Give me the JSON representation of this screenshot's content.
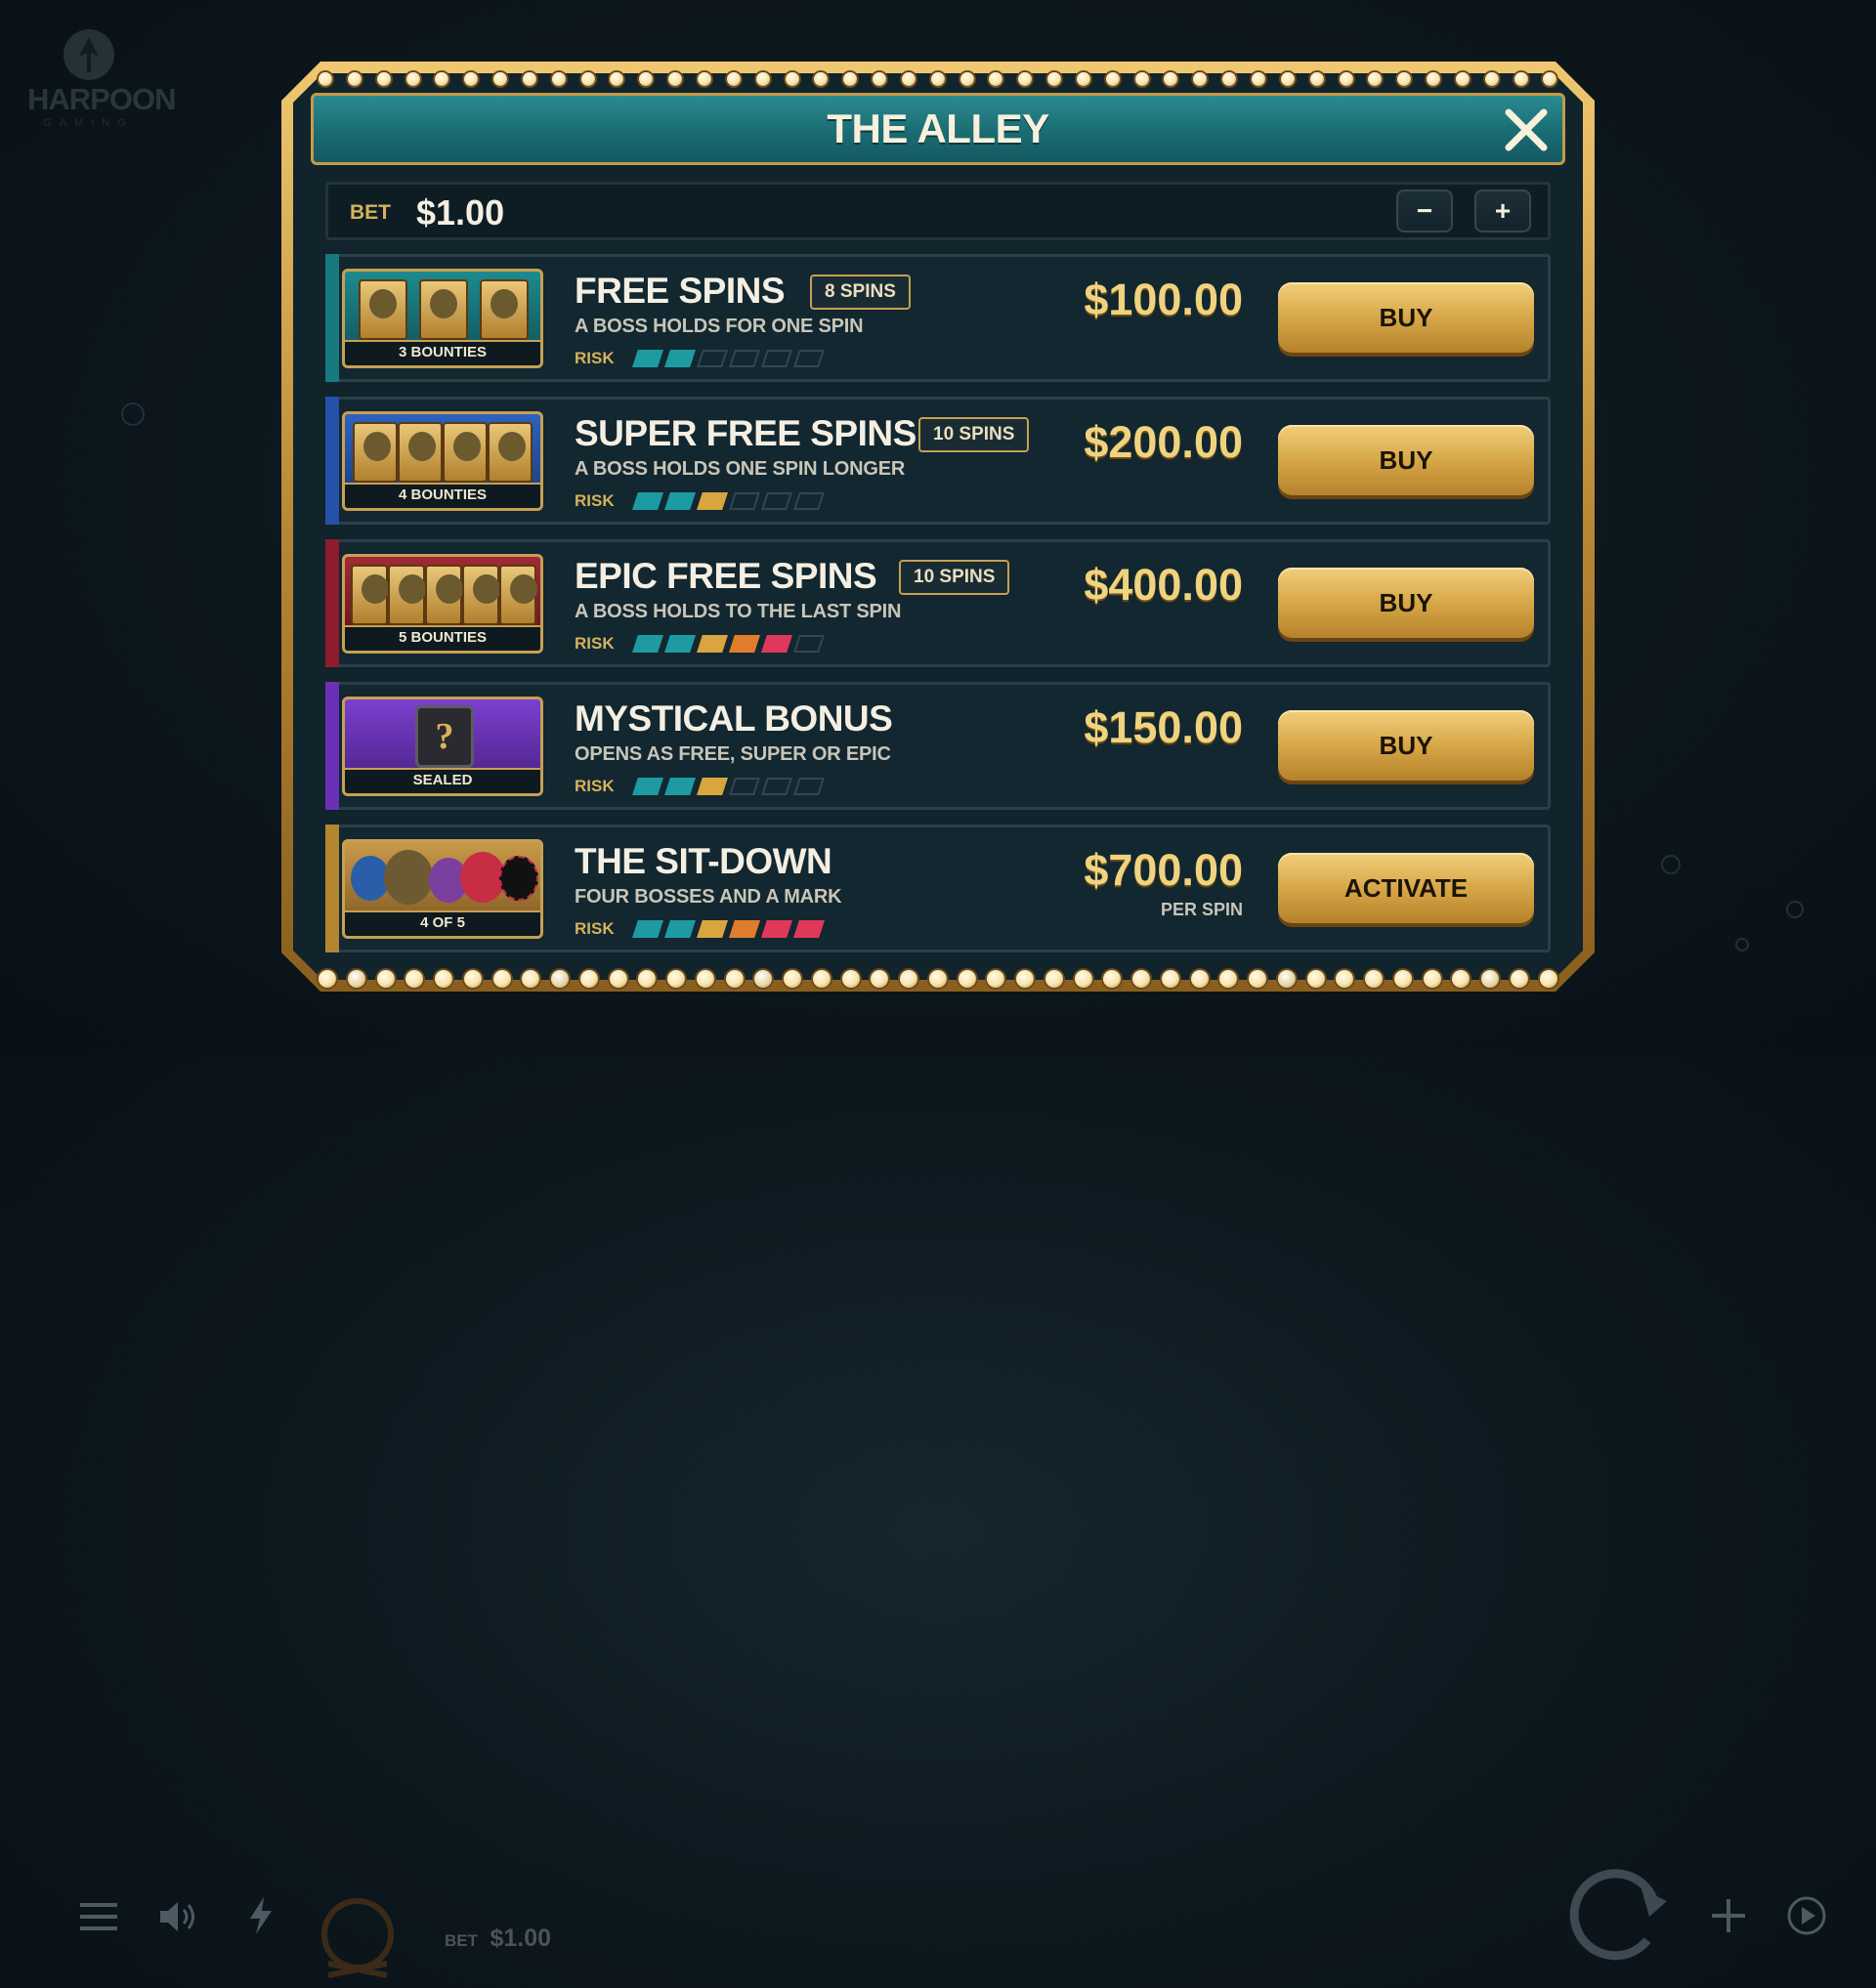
{
  "brand": {
    "name": "HARPOON",
    "sub": "GAMING"
  },
  "modal": {
    "title": "THE ALLEY"
  },
  "bet": {
    "label": "BET",
    "value": "$1.00",
    "minus": "−",
    "plus": "+"
  },
  "offers": [
    {
      "name": "FREE SPINS",
      "tag": "8 SPINS",
      "desc": "A BOSS HOLDS FOR ONE SPIN",
      "thumb_caption": "3 BOUNTIES",
      "price": "$100.00",
      "button": "BUY",
      "risk_label": "RISK",
      "risk": [
        "teal",
        "teal",
        "empty",
        "empty",
        "empty",
        "empty"
      ]
    },
    {
      "name": "SUPER FREE SPINS",
      "tag": "10 SPINS",
      "desc": "A BOSS HOLDS ONE SPIN LONGER",
      "thumb_caption": "4 BOUNTIES",
      "price": "$200.00",
      "button": "BUY",
      "risk_label": "RISK",
      "risk": [
        "teal",
        "teal",
        "gold",
        "empty",
        "empty",
        "empty"
      ]
    },
    {
      "name": "EPIC FREE SPINS",
      "tag": "10 SPINS",
      "desc": "A BOSS HOLDS TO THE LAST SPIN",
      "thumb_caption": "5 BOUNTIES",
      "price": "$400.00",
      "button": "BUY",
      "risk_label": "RISK",
      "risk": [
        "teal",
        "teal",
        "gold",
        "orange",
        "red",
        "empty"
      ]
    },
    {
      "name": "MYSTICAL BONUS",
      "desc": "OPENS AS FREE, SUPER OR EPIC",
      "thumb_caption": "SEALED",
      "price": "$150.00",
      "button": "BUY",
      "risk_label": "RISK",
      "risk": [
        "teal",
        "teal",
        "gold",
        "empty",
        "empty",
        "empty"
      ]
    },
    {
      "name": "THE SIT-DOWN",
      "desc": "FOUR BOSSES AND A MARK",
      "thumb_caption": "4 OF 5",
      "price": "$700.00",
      "price_note": "PER SPIN",
      "button": "ACTIVATE",
      "risk_label": "RISK",
      "risk": [
        "teal",
        "teal",
        "gold",
        "orange",
        "red",
        "red"
      ]
    }
  ],
  "bottom_bar": {
    "bet_label": "BET",
    "bet_value": "$1.00"
  },
  "colors": {
    "teal": "#1e9aa2",
    "gold": "#d9a53f",
    "orange": "#e07d2d",
    "red": "#e0385a",
    "stripe_free": "#177a7e",
    "stripe_super": "#2552a8",
    "stripe_epic": "#8e1c2c",
    "stripe_mystic": "#6a31b8",
    "stripe_sitdown": "#b48632"
  }
}
